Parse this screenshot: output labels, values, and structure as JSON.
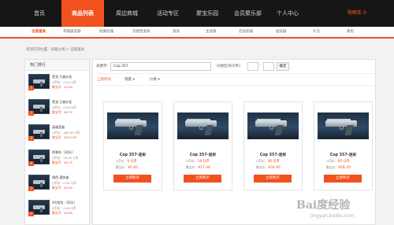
{
  "top_nav": {
    "items": [
      {
        "label": "首页"
      },
      {
        "label": "商品列表"
      },
      {
        "label": "周边商城"
      },
      {
        "label": "活动专区"
      },
      {
        "label": "聚宝乐园"
      },
      {
        "label": "会员聚乐部"
      },
      {
        "label": "个人中心"
      }
    ],
    "active_index": 1,
    "cart_label": "购物车",
    "cart_count": "0"
  },
  "categories": {
    "items": [
      "全部道具",
      "英雄级武器",
      "投掷武器",
      "功能性道具",
      "道具",
      "主武器",
      "近战武器",
      "副武器",
      "礼包",
      "角色"
    ],
    "active_index": 0
  },
  "breadcrumb": "您现在的位置：穿越火线 > 全部道具",
  "sidebar": {
    "title": "热门排行",
    "items": [
      {
        "rank": "1",
        "name": "黑龙·王者幻化",
        "price_label": "Q币价：",
        "price": "0.00 Q币",
        "points_label": "聚宝币：",
        "points": "¥4.85"
      },
      {
        "rank": "2",
        "name": "黑龙·王者幻化",
        "price_label": "Q币价：",
        "price": "0.00 Q币",
        "points_label": "聚宝币：",
        "points": "¥9.70"
      },
      {
        "rank": "3",
        "name": "英雄武器",
        "price_label": "Q币价：",
        "price": "480.00 Q币",
        "points_label": "聚宝币：",
        "points": "¥473.36"
      },
      {
        "rank": "4",
        "name": "防弹衣（30天）",
        "price_label": "Q币价：",
        "price": "10.00 Q币",
        "points_label": "聚宝币：",
        "points": "¥9.70"
      },
      {
        "rank": "5",
        "name": "角色·潜伏者",
        "price_label": "Q币价：",
        "price": "0.00 Q币",
        "points_label": "聚宝币：",
        "points": "¥4.85"
      },
      {
        "rank": "6",
        "name": "4号背包（30天）",
        "price_label": "Q币价：",
        "price": "0.00 Q币",
        "points_label": "聚宝币：",
        "points": "¥4.85"
      }
    ]
  },
  "filter": {
    "keyword_label": "关键字：",
    "keyword_value": "Cop 357",
    "price_label": "价格区间(Q币)：",
    "dash": "-",
    "confirm_label": "确定"
  },
  "sort": {
    "items": [
      "上架时间",
      "销量",
      "价格"
    ],
    "active_index": 0
  },
  "products": [
    {
      "title": "Cop 357-迷彩",
      "price_label": "Q币价：",
      "price": "6 Q币",
      "points_label": "聚宝价：",
      "points": "¥5.82",
      "buy_label": "立即购买"
    },
    {
      "title": "Cop 357-迷彩",
      "price_label": "Q币价：",
      "price": "18 Q币",
      "points_label": "聚宝价：",
      "points": "¥17.46",
      "buy_label": "立即购买"
    },
    {
      "title": "Cop 357-迷彩",
      "price_label": "Q币价：",
      "price": "36 Q币",
      "points_label": "聚宝价：",
      "points": "¥34.92",
      "buy_label": "立即购买"
    },
    {
      "title": "Cop 357-迷彩",
      "price_label": "Q币价：",
      "price": "60 Q币",
      "points_label": "聚宝价：",
      "points": "¥58.20",
      "buy_label": "立即购买"
    }
  ],
  "watermark": {
    "brand": "Bai度经验",
    "url": "jingyan.baidu.com"
  }
}
